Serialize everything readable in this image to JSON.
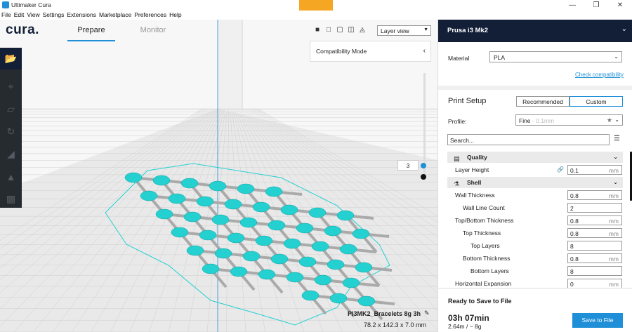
{
  "window": {
    "title": "Ultimaker Cura"
  },
  "menu": [
    "File",
    "Edit",
    "View",
    "Settings",
    "Extensions",
    "Marketplace",
    "Preferences",
    "Help"
  ],
  "header": {
    "logo": "cura.",
    "tabs": [
      {
        "label": "Prepare",
        "active": true
      },
      {
        "label": "Monitor",
        "active": false
      }
    ]
  },
  "view": {
    "selected": "Layer view",
    "compatibility": "Compatibility Mode"
  },
  "layer": {
    "current": "3"
  },
  "job": {
    "name": "PI3MK2_Bracelets 8g 3h",
    "dims": "78.2 x 142.3 x 7.0 mm"
  },
  "panel": {
    "printer": "Prusa i3 Mk2",
    "material_label": "Material",
    "material_value": "PLA",
    "check_compat": "Check compatibility",
    "setup_title": "Print Setup",
    "recommended": "Recommended",
    "custom": "Custom",
    "profile_label": "Profile:",
    "profile_value": "Fine",
    "profile_sub": "- 0.1mm",
    "search_placeholder": "Search...",
    "quality_cat": "Quality",
    "shell_cat": "Shell",
    "settings": [
      {
        "label": "Layer Height",
        "value": "0.1",
        "unit": "mm"
      },
      {
        "label": "Wall Thickness",
        "value": "0.8",
        "unit": "mm"
      },
      {
        "label": "Wall Line Count",
        "value": "2",
        "unit": ""
      },
      {
        "label": "Top/Bottom Thickness",
        "value": "0.8",
        "unit": "mm"
      },
      {
        "label": "Top Thickness",
        "value": "0.8",
        "unit": "mm"
      },
      {
        "label": "Top Layers",
        "value": "8",
        "unit": ""
      },
      {
        "label": "Bottom Thickness",
        "value": "0.8",
        "unit": "mm"
      },
      {
        "label": "Bottom Layers",
        "value": "8",
        "unit": ""
      },
      {
        "label": "Horizontal Expansion",
        "value": "0",
        "unit": "mm"
      }
    ],
    "ready": "Ready to Save to File",
    "time": "03h 07min",
    "usage": "2.64m / ~ 8g",
    "save": "Save to File"
  },
  "colors": {
    "accent": "#1f8fd8",
    "dark": "#131f37",
    "model": "#25d0d0"
  }
}
